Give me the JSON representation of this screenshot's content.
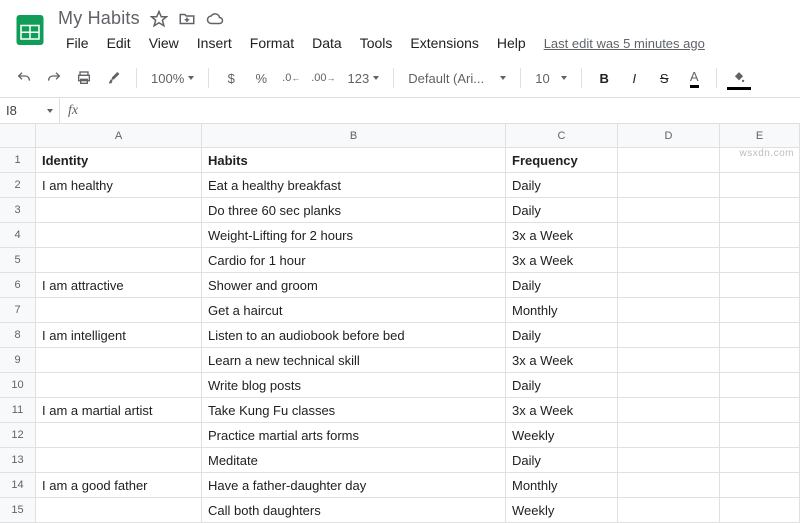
{
  "doc": {
    "title": "My Habits",
    "last_edit": "Last edit was 5 minutes ago"
  },
  "menus": [
    "File",
    "Edit",
    "View",
    "Insert",
    "Format",
    "Data",
    "Tools",
    "Extensions",
    "Help"
  ],
  "toolbar": {
    "zoom": "100%",
    "currency": "$",
    "percent": "%",
    "dec_dec": ".0",
    "inc_dec": ".00",
    "num_format": "123",
    "font": "Default (Ari...",
    "font_size": "10",
    "bold": "B",
    "italic": "I",
    "strike": "S",
    "text_color": "A"
  },
  "namebox": "I8",
  "formula": "",
  "columns": [
    "A",
    "B",
    "C",
    "D",
    "E"
  ],
  "rows": [
    {
      "n": "1",
      "a": "Identity",
      "b": "Habits",
      "c": "Frequency",
      "head": true
    },
    {
      "n": "2",
      "a": "I am healthy",
      "b": "Eat a healthy breakfast",
      "c": "Daily"
    },
    {
      "n": "3",
      "a": "",
      "b": "Do three 60 sec planks",
      "c": "Daily"
    },
    {
      "n": "4",
      "a": "",
      "b": "Weight-Lifting for 2 hours",
      "c": "3x a Week"
    },
    {
      "n": "5",
      "a": "",
      "b": "Cardio for 1 hour",
      "c": "3x a Week"
    },
    {
      "n": "6",
      "a": "I am attractive",
      "b": "Shower and groom",
      "c": "Daily"
    },
    {
      "n": "7",
      "a": "",
      "b": "Get a haircut",
      "c": "Monthly"
    },
    {
      "n": "8",
      "a": "I am intelligent",
      "b": "Listen to an audiobook before bed",
      "c": "Daily"
    },
    {
      "n": "9",
      "a": "",
      "b": "Learn a new technical skill",
      "c": "3x a Week"
    },
    {
      "n": "10",
      "a": "",
      "b": "Write blog posts",
      "c": "Daily"
    },
    {
      "n": "11",
      "a": "I am a martial artist",
      "b": "Take Kung Fu classes",
      "c": "3x a Week"
    },
    {
      "n": "12",
      "a": "",
      "b": "Practice martial arts forms",
      "c": "Weekly"
    },
    {
      "n": "13",
      "a": "",
      "b": "Meditate",
      "c": "Daily"
    },
    {
      "n": "14",
      "a": "I am a good father",
      "b": "Have a father-daughter day",
      "c": "Monthly"
    },
    {
      "n": "15",
      "a": "",
      "b": "Call both daughters",
      "c": "Weekly"
    }
  ],
  "watermark": "wsxdn.com"
}
